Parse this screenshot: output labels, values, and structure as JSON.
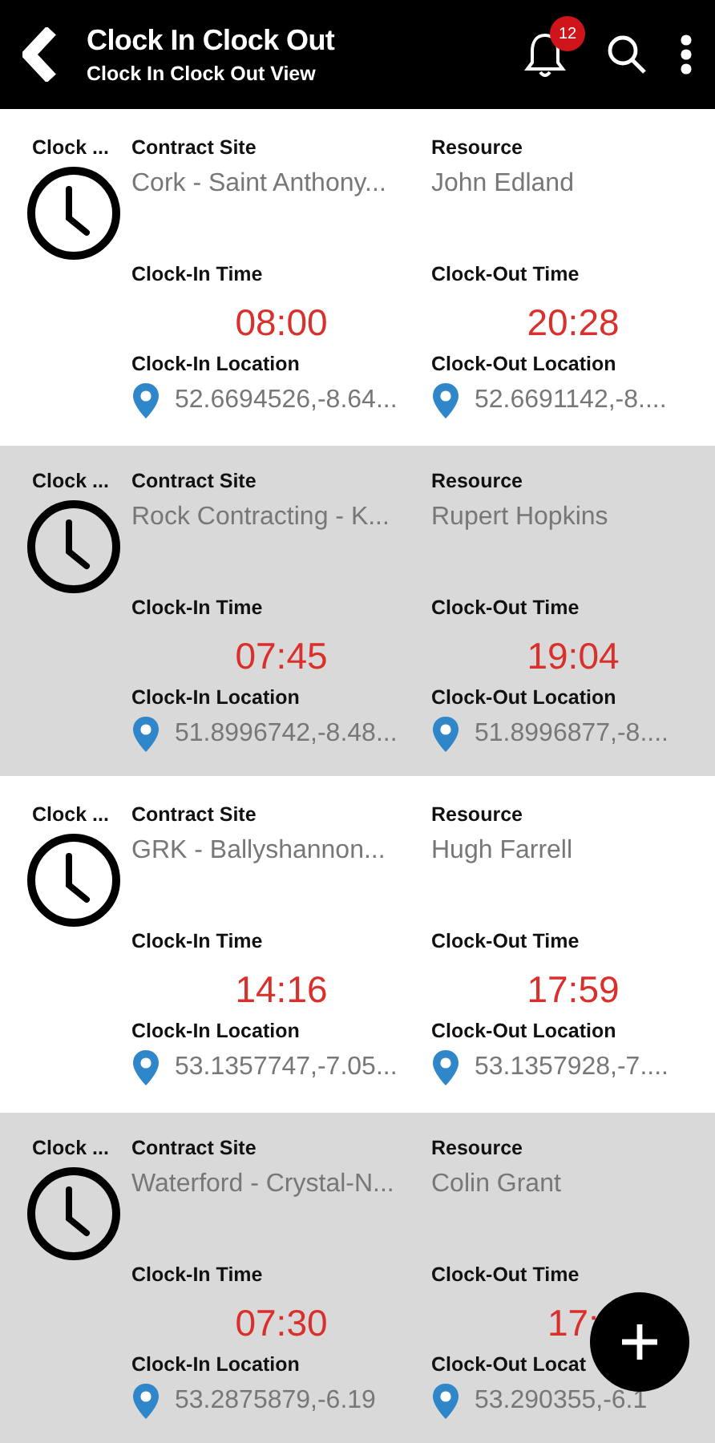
{
  "header": {
    "title": "Clock In Clock Out",
    "subtitle": "Clock In Clock Out View",
    "notification_count": "12"
  },
  "entries": [
    {
      "entry_label": "Clock ...",
      "site_label": "Contract Site",
      "site": "Cork - Saint Anthony...",
      "resource_label": "Resource",
      "resource": "John Edland",
      "clock_in_time_label": "Clock-In Time",
      "clock_in_time": "08:00",
      "clock_out_time_label": "Clock-Out Time",
      "clock_out_time": "20:28",
      "clock_in_location_label": "Clock-In Location",
      "clock_in_location": "52.6694526,-8.64...",
      "clock_out_location_label": "Clock-Out Location",
      "clock_out_location": "52.6691142,-8...."
    },
    {
      "entry_label": "Clock ...",
      "site_label": "Contract Site",
      "site": "Rock Contracting - K...",
      "resource_label": "Resource",
      "resource": "Rupert Hopkins",
      "clock_in_time_label": "Clock-In Time",
      "clock_in_time": "07:45",
      "clock_out_time_label": "Clock-Out Time",
      "clock_out_time": "19:04",
      "clock_in_location_label": "Clock-In Location",
      "clock_in_location": "51.8996742,-8.48...",
      "clock_out_location_label": "Clock-Out Location",
      "clock_out_location": "51.8996877,-8...."
    },
    {
      "entry_label": "Clock ...",
      "site_label": "Contract Site",
      "site": "GRK - Ballyshannon...",
      "resource_label": "Resource",
      "resource": "Hugh Farrell",
      "clock_in_time_label": "Clock-In Time",
      "clock_in_time": "14:16",
      "clock_out_time_label": "Clock-Out Time",
      "clock_out_time": "17:59",
      "clock_in_location_label": "Clock-In Location",
      "clock_in_location": "53.1357747,-7.05...",
      "clock_out_location_label": "Clock-Out Location",
      "clock_out_location": "53.1357928,-7...."
    },
    {
      "entry_label": "Clock ...",
      "site_label": "Contract Site",
      "site": "Waterford - Crystal-N...",
      "resource_label": "Resource",
      "resource": "Colin Grant",
      "clock_in_time_label": "Clock-In Time",
      "clock_in_time": "07:30",
      "clock_out_time_label": "Clock-Out Time",
      "clock_out_time": "17:",
      "clock_in_location_label": "Clock-In Location",
      "clock_in_location": "53.2875879,-6.19",
      "clock_out_location_label": "Clock-Out Locat",
      "clock_out_location": "53.290355,-6.1"
    }
  ]
}
